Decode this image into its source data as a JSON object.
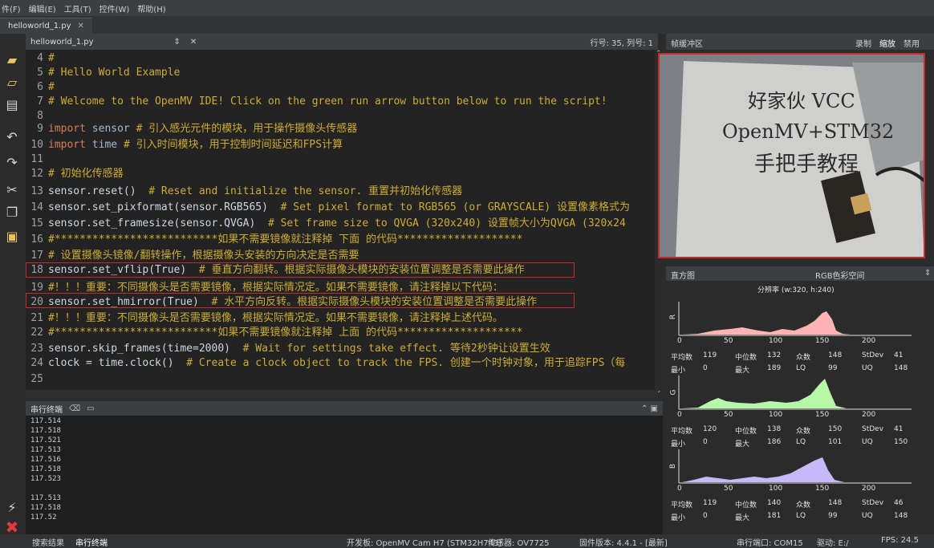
{
  "menu": {
    "items": [
      "件(F)",
      "编辑(E)",
      "工具(T)",
      "控件(W)",
      "帮助(H)"
    ]
  },
  "window_tab": {
    "label": "helloworld_1.py",
    "close": "✕"
  },
  "editor_header": {
    "filename": "helloworld_1.py",
    "arrows": "⇕",
    "close": "✕",
    "position": "行号: 35, 列号: 1"
  },
  "code": {
    "line_numbers": [
      "4",
      "5",
      "6",
      "7",
      "8",
      "9",
      "10",
      "11",
      "12",
      "13",
      "14",
      "15",
      "16",
      "17",
      "18",
      "19",
      "20",
      "21",
      "22",
      "23",
      "24",
      "25"
    ],
    "l4": "#",
    "l5": "# Hello World Example",
    "l6": "#",
    "l7": "# Welcome to the OpenMV IDE! Click on the green run arrow button below to run the script!",
    "l8": "",
    "l9_kw": "import",
    "l9_mod": "sensor",
    "l9_cmt": "# 引入感光元件的模块，用于操作摄像头传感器",
    "l10_kw": "import",
    "l10_mod": "time",
    "l10_cmt": "# 引入时间模块，用于控制时间延迟和FPS计算",
    "l11": "",
    "l12": "# 初始化传感器",
    "l13_code": "sensor.reset()",
    "l13_cmt": "# Reset and initialize the sensor. 重置并初始化传感器",
    "l14_code": "sensor.set_pixformat(sensor.RGB565)",
    "l14_cmt": "# Set pixel format to RGB565 (or GRAYSCALE) 设置像素格式为",
    "l15_code": "sensor.set_framesize(sensor.QVGA)",
    "l15_cmt": "# Set frame size to QVGA (320x240) 设置帧大小为QVGA (320x24",
    "l16": "#**************************如果不需要镜像就注释掉 下面 的代码********************",
    "l17": "# 设置摄像头镜像/翻转操作，根据摄像头安装的方向决定是否需要",
    "l18_code": "sensor.set_vflip(True)",
    "l18_cmt": "# 垂直方向翻转。根据实际摄像头模块的安装位置调整是否需要此操作",
    "l19": "#！！！重要：不同摄像头是否需要镜像，根据实际情况定。如果不需要镜像，请注释掉以下代码：",
    "l20_code": "sensor.set_hmirror(True)",
    "l20_cmt": "# 水平方向反转。根据实际摄像头模块的安装位置调整是否需要此操作",
    "l21": "#！！！重要：不同摄像头是否需要镜像，根据实际情况定。如果不需要镜像，请注释掉上述代码。",
    "l22": "#**************************如果不需要镜像就注释掉 上面 的代码********************",
    "l23_code": "sensor.skip_frames(time=2000)",
    "l23_cmt": "# Wait for settings take effect. 等待2秒钟让设置生效",
    "l24_code": "clock = time.clock()",
    "l24_cmt": "# Create a clock object to track the FPS. 创建一个时钟对象，用于追踪FPS（每",
    "l25": ""
  },
  "terminal": {
    "title": "串行终端",
    "lines": [
      "117.514",
      "117.518",
      "117.521",
      "117.513",
      "117.516",
      "117.518",
      "117.523",
      "117.513",
      "117.518",
      "117.52"
    ]
  },
  "status": {
    "tab1": "搜索结果",
    "tab2": "串行终端",
    "board": "开发板: OpenMV Cam H7 (STM32H743)",
    "sensor": "传感器: OV7725",
    "firmware": "固件版本: 4.4.1 - [最新]",
    "port": "串行端口: COM15",
    "drive": "驱动: E:/",
    "fps": "FPS: 24.5"
  },
  "framebuffer": {
    "title": "帧缓冲区",
    "record": "录制",
    "zoom": "缩放",
    "disable": "禁用",
    "text_line1": "好家伙 VCC",
    "text_line2": "OpenMV+STM32",
    "text_line3": "手把手教程"
  },
  "histogram": {
    "title": "直方图",
    "colorspace": "RGB色彩空间",
    "resolution": "分辨率 (w:320, h:240)",
    "x_ticks": [
      "0",
      "50",
      "100",
      "150",
      "200"
    ],
    "channels": [
      {
        "label": "R",
        "color": "#ffb3b3",
        "mean": "119",
        "median": "132",
        "mode": "148",
        "stdev": "41",
        "min": "0",
        "max": "189",
        "lq": "99",
        "uq": "148"
      },
      {
        "label": "G",
        "color": "#b6f7a8",
        "mean": "120",
        "median": "138",
        "mode": "150",
        "stdev": "41",
        "min": "0",
        "max": "186",
        "lq": "101",
        "uq": "150"
      },
      {
        "label": "B",
        "color": "#c6b9f7",
        "mean": "119",
        "median": "140",
        "mode": "148",
        "stdev": "46",
        "min": "0",
        "max": "181",
        "lq": "99",
        "uq": "148"
      }
    ],
    "labels": {
      "mean": "平均数",
      "median": "中位数",
      "mode": "众数",
      "stdev": "StDev",
      "min": "最小",
      "max": "最大",
      "lq": "LQ",
      "uq": "UQ"
    }
  },
  "colors": {
    "highlight_box": "#c72a2a",
    "comment": "#ccac33",
    "keyword": "#d57b5a"
  }
}
